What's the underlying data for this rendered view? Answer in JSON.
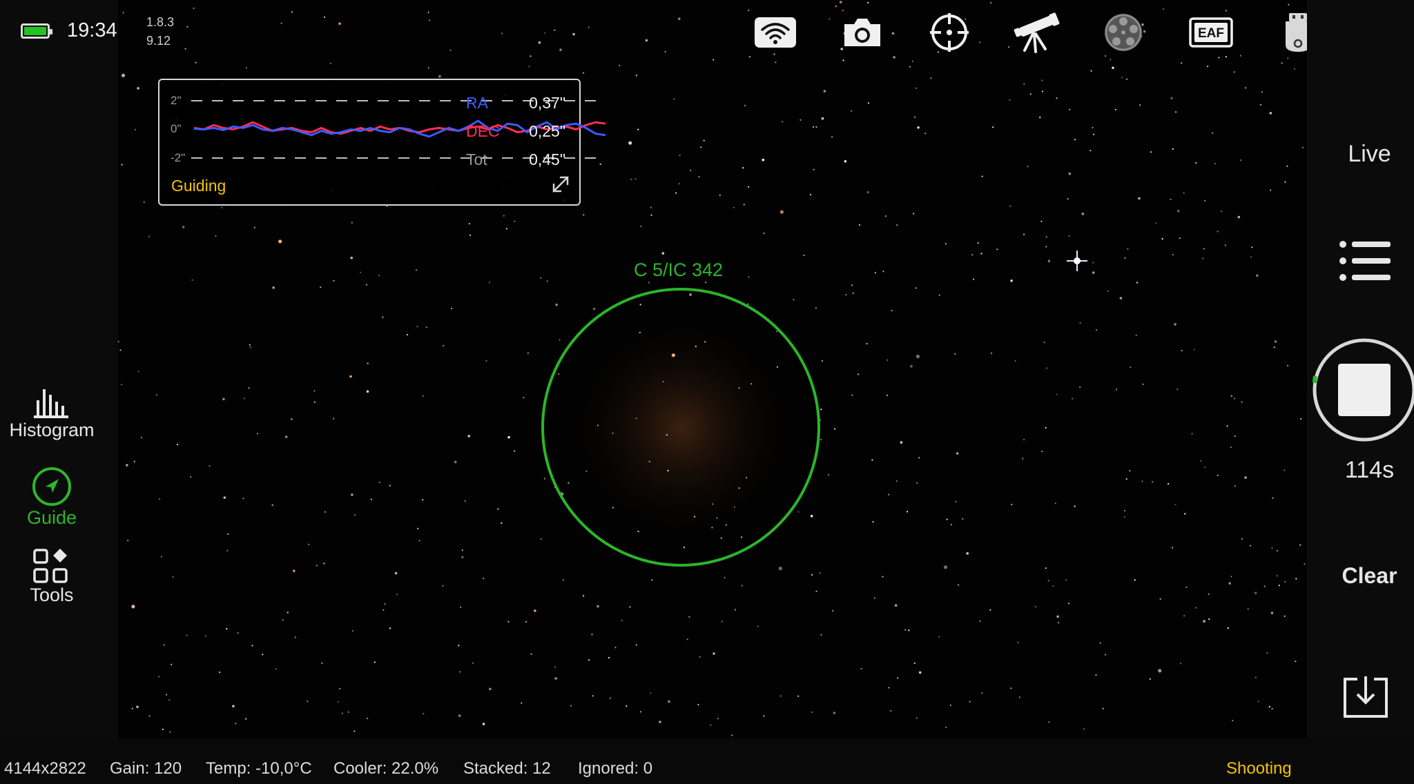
{
  "status_bar": {
    "time": "19:34",
    "version_1": "1.8.3",
    "version_2": "9.12",
    "battery_color": "#22c41f"
  },
  "toolbar_icons": [
    "wifi-icon",
    "camera-icon",
    "focus-target-icon",
    "telescope-icon",
    "filter-wheel-icon",
    "eaf-icon",
    "usb-drive-icon",
    "info-icon"
  ],
  "eaf_label": "EAF",
  "left_nav": {
    "histogram": "Histogram",
    "guide": "Guide",
    "tools": "Tools",
    "guide_color": "#2fb52c"
  },
  "guide_graph": {
    "y_labels": [
      "2\"",
      "0\"",
      "-2\""
    ],
    "ra_label": "RA",
    "ra_value": "0,37\"",
    "dec_label": "DEC",
    "dec_value": "0,25\"",
    "tot_label": "Tot",
    "tot_value": "0,45\"",
    "status": "Guiding",
    "ra_color": "#3c5bff",
    "dec_color": "#ff2f52",
    "ra_series": [
      0.05,
      0.0,
      0.1,
      -0.05,
      0.2,
      0.1,
      0.3,
      0.0,
      -0.1,
      0.1,
      0.0,
      -0.2,
      -0.4,
      -0.1,
      -0.3,
      -0.2,
      0.0,
      -0.1,
      0.1,
      -0.1,
      -0.2,
      0.1,
      0.0,
      -0.3,
      -0.5,
      -0.2,
      0.1,
      -0.1,
      0.2,
      0.6,
      0.1,
      -0.1,
      0.4,
      0.3,
      -0.2,
      0.2,
      0.5,
      0.0,
      0.3,
      0.4,
      0.1,
      -0.3,
      -0.4
    ],
    "dec_series": [
      0.1,
      0.0,
      0.3,
      0.1,
      0.0,
      0.2,
      0.5,
      0.2,
      -0.1,
      0.0,
      0.1,
      -0.1,
      -0.2,
      0.1,
      -0.2,
      -0.3,
      -0.1,
      0.1,
      -0.1,
      0.2,
      0.0,
      0.1,
      -0.1,
      -0.2,
      0.0,
      0.1,
      0.0,
      -0.1,
      0.1,
      0.2,
      0.0,
      0.3,
      0.1,
      -0.2,
      -0.1,
      0.2,
      0.0,
      0.1,
      0.2,
      0.0,
      0.3,
      0.5,
      0.4
    ]
  },
  "target": {
    "label": "C 5/IC 342",
    "color": "#2bb52a"
  },
  "right_panel": {
    "live": "Live",
    "exposure_time": "114s",
    "clear": "Clear"
  },
  "bottom_bar": {
    "resolution": "4144x2822",
    "gain": "Gain: 120",
    "temp": "Temp: -10,0°C",
    "cooler": "Cooler: 22.0%",
    "stacked": "Stacked: 12",
    "ignored": "Ignored: 0",
    "status": "Shooting",
    "status_color": "#f5c400"
  }
}
